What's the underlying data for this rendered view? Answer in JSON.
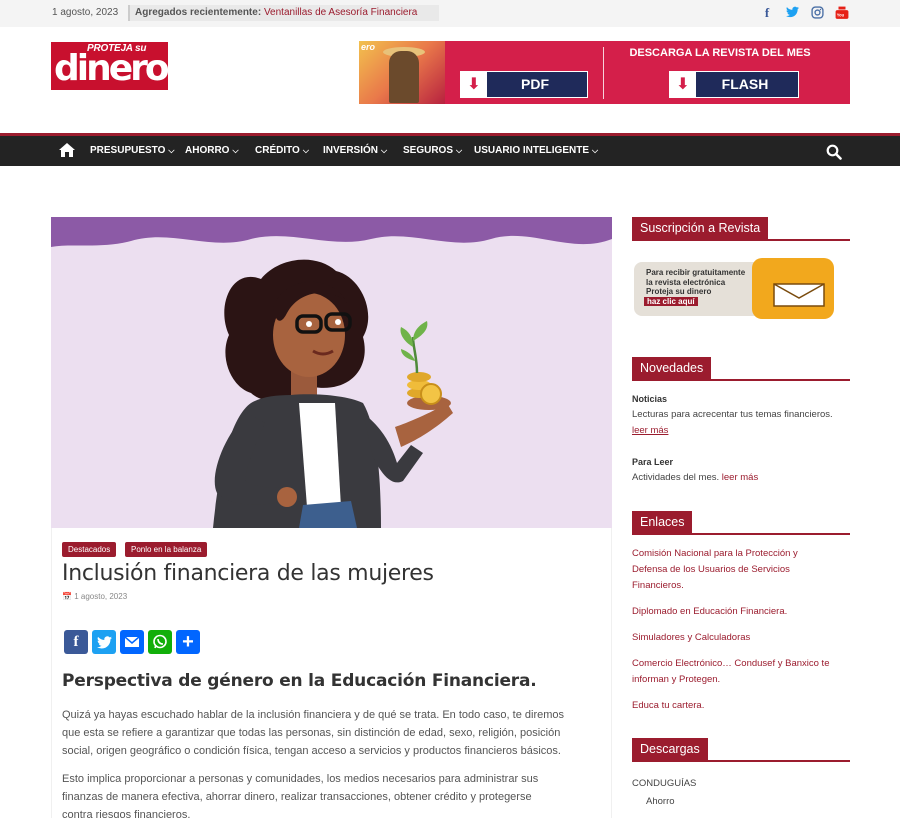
{
  "topbar": {
    "date": "1 agosto, 2023",
    "recent_label": "Agregados recientemente:",
    "recent_value": "Ventanillas de Asesoría Financiera",
    "social": [
      "facebook-icon",
      "twitter-icon",
      "instagram-icon",
      "youtube-icon"
    ]
  },
  "header": {
    "logo_small": "PROTEJA su",
    "logo_big": "dinero",
    "banner": {
      "mini_cover": "ero",
      "headline": "DESCARGA LA REVISTA DEL MES",
      "pdf_label": "PDF",
      "flash_label": "FLASH"
    }
  },
  "nav": {
    "items": [
      "PRESUPUESTO",
      "AHORRO",
      "CRÉDITO",
      "INVERSIÓN",
      "SEGUROS",
      "USUARIO INTELIGENTE"
    ]
  },
  "article": {
    "tags": [
      "Destacados",
      "Ponlo en la balanza"
    ],
    "title": "Inclusión financiera de las mujeres",
    "date": "1 agosto, 2023",
    "share": [
      "facebook-icon",
      "twitter-icon",
      "email-icon",
      "whatsapp-icon",
      "share-icon"
    ],
    "subhead": "Perspectiva de género en la Educación Financiera.",
    "p1": [
      "Quizá ya hayas escuchado hablar de la inclusión financiera y de qué se trata. En todo caso, te diremos",
      "que esta se refiere a garantizar que todas las personas, sin distinción de edad, sexo, religión, posición",
      "social, origen geográfico o condición física, tengan acceso a servicios y productos financieros básicos."
    ],
    "p2": [
      "Esto implica proporcionar a personas y comunidades, los medios necesarios para administrar sus",
      "finanzas de manera efectiva, ahorrar dinero, realizar transacciones, obtener crédito y protegerse",
      "contra riesgos financieros."
    ]
  },
  "sidebar": {
    "subscription": {
      "title": "Suscripción a Revista",
      "lines": [
        "Para recibir gratuitamente",
        "la revista electrónica",
        "Proteja su dinero"
      ],
      "cta": "haz clic aquí"
    },
    "novedades": {
      "title": "Novedades",
      "noticias_title": "Noticias",
      "noticias_text": "Lecturas para acrecentar tus temas financieros.",
      "noticias_link": "leer más",
      "leer_title": "Para Leer",
      "leer_text": "Actividades del mes.",
      "leer_link": "leer más"
    },
    "enlaces": {
      "title": "Enlaces",
      "links": [
        [
          "Comisión Nacional para la Protección y",
          "Defensa de los Usuarios de Servicios",
          "Financieros."
        ],
        [
          "Diplomado en Educación Financiera."
        ],
        [
          "Simuladores y Calculadoras"
        ],
        [
          "Comercio Electrónico… Condusef y Banxico te",
          "informan y Protegen."
        ],
        [
          "Educa tu cartera."
        ]
      ]
    },
    "descargas": {
      "title": "Descargas",
      "category": "CONDUGUÍAS",
      "item": "Ahorro"
    }
  },
  "colors": {
    "brand": "#9b1c2e",
    "nav_bg": "#232323",
    "hero_bg": "#ecdff0",
    "hero_wave": "#8c5aa6"
  }
}
